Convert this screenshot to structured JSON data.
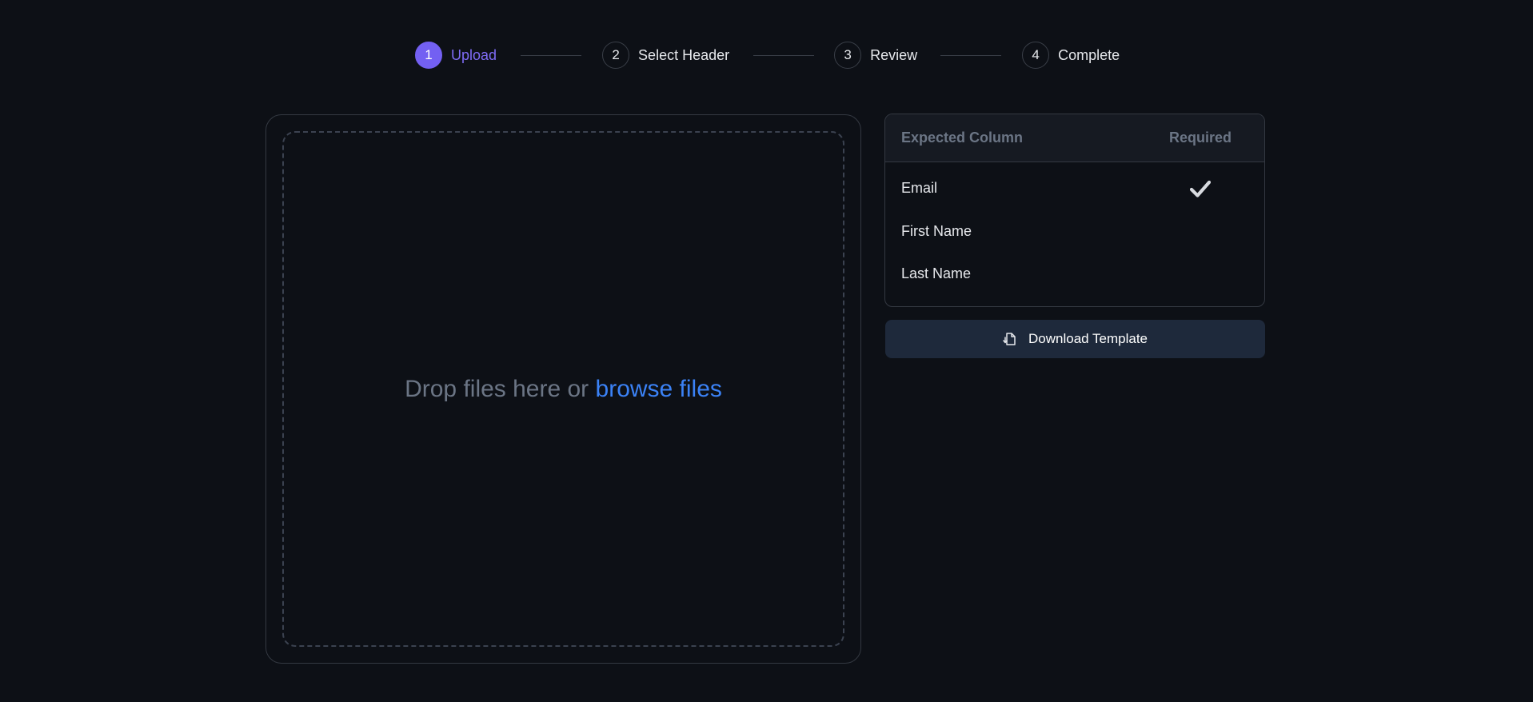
{
  "stepper": {
    "steps": [
      {
        "number": "1",
        "label": "Upload",
        "active": true
      },
      {
        "number": "2",
        "label": "Select Header",
        "active": false
      },
      {
        "number": "3",
        "label": "Review",
        "active": false
      },
      {
        "number": "4",
        "label": "Complete",
        "active": false
      }
    ]
  },
  "dropzone": {
    "text": "Drop files here or ",
    "link_text": "browse files"
  },
  "columns_table": {
    "headers": {
      "name": "Expected Column",
      "required": "Required"
    },
    "rows": [
      {
        "name": "Email",
        "required": true
      },
      {
        "name": "First Name",
        "required": false
      },
      {
        "name": "Last Name",
        "required": false
      }
    ]
  },
  "download_button": {
    "label": "Download Template",
    "icon": "download-file-icon"
  },
  "colors": {
    "background": "#0d1016",
    "accent": "#7360f2",
    "link": "#3b82f6",
    "button_bg": "#1e293b"
  }
}
